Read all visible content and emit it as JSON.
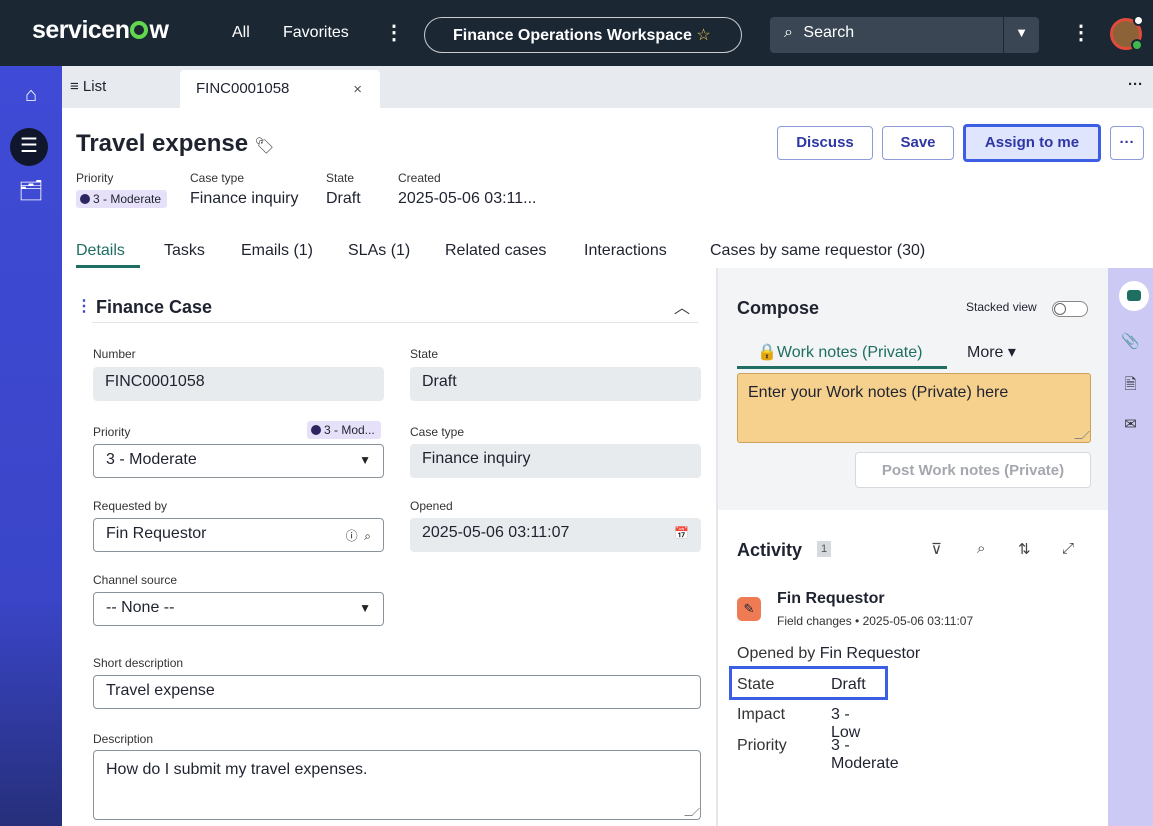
{
  "header": {
    "brand": "servicenow",
    "nav": [
      "All",
      "Favorites"
    ],
    "workspace": "Finance Operations Workspace",
    "search_placeholder": "Search"
  },
  "tabs": {
    "list_label": "List",
    "record_tab": "FINC0001058"
  },
  "record": {
    "title": "Travel expense",
    "meta": [
      {
        "label": "Priority",
        "value": "3 - Moderate"
      },
      {
        "label": "Case type",
        "value": "Finance inquiry"
      },
      {
        "label": "State",
        "value": "Draft"
      },
      {
        "label": "Created",
        "value": "2025-05-06 03:11..."
      }
    ],
    "actions": {
      "discuss": "Discuss",
      "save": "Save",
      "assign": "Assign to me",
      "more": "···"
    }
  },
  "form_tabs": [
    "Details",
    "Tasks",
    "Emails (1)",
    "SLAs (1)",
    "Related cases",
    "Interactions",
    "Cases by same requestor (30)"
  ],
  "finance_case": {
    "title": "Finance Case",
    "number_label": "Number",
    "number": "FINC0001058",
    "state_label": "State",
    "state": "Draft",
    "priority_label": "Priority",
    "priority": "3 - Moderate",
    "priority_badge": "3 - Mod...",
    "case_type_label": "Case type",
    "case_type": "Finance inquiry",
    "requested_by_label": "Requested by",
    "requested_by": "Fin Requestor",
    "opened_label": "Opened",
    "opened": "2025-05-06 03:11:07",
    "channel_label": "Channel source",
    "channel": "-- None --",
    "short_desc_label": "Short description",
    "short_desc": "Travel expense",
    "desc_label": "Description",
    "desc": "How do I submit my travel expenses."
  },
  "compose": {
    "title": "Compose",
    "stacked_view": "Stacked view",
    "work_notes_tab": "Work notes (Private)",
    "more_tab": "More",
    "placeholder": "Enter your Work notes (Private) here",
    "post_button": "Post Work notes (Private)"
  },
  "activity": {
    "title": "Activity",
    "count": "1",
    "author": "Fin Requestor",
    "subtitle": "Field changes • 2025-05-06 03:11:07",
    "opened_by_label": "Opened by",
    "opened_by": "Fin Requestor",
    "changes": [
      {
        "label": "State",
        "value": "Draft"
      },
      {
        "label": "Impact",
        "value": "3 - Low"
      },
      {
        "label": "Priority",
        "value": "3 - Moderate"
      }
    ]
  },
  "colors": {
    "header_bg": "#1b2733",
    "left_rail": "#3f4bd6",
    "accent_teal": "#1f6e62",
    "highlight": "#3b5ee3",
    "work_notes_bg": "#f6d08d"
  }
}
